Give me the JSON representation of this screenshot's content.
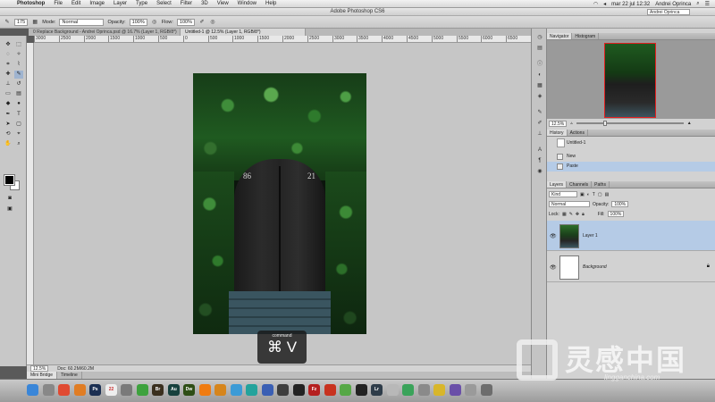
{
  "menubar": {
    "app": "Photoshop",
    "items": [
      "File",
      "Edit",
      "Image",
      "Layer",
      "Type",
      "Select",
      "Filter",
      "3D",
      "View",
      "Window",
      "Help"
    ],
    "clock": "mar 22 jul  12:32",
    "user": "Andrei Oprinca"
  },
  "window": {
    "title": "Adobe Photoshop CS6",
    "workspace": "Andrei Oprinca"
  },
  "options": {
    "brush_size": "175",
    "mode_label": "Mode:",
    "mode_value": "Normal",
    "opacity_label": "Opacity:",
    "opacity_value": "100%",
    "flow_label": "Flow:",
    "flow_value": "100%"
  },
  "tabs": [
    {
      "label": "0 Replace Background - Andrei Oprinca.psd @ 16.7% (Layer 1, RGB/8*)",
      "active": false
    },
    {
      "label": "Untitled-1 @ 12.5% (Layer 1, RGB/8*)",
      "active": true
    }
  ],
  "ruler": [
    "3000",
    "2500",
    "2000",
    "1500",
    "1000",
    "500",
    "0",
    "500",
    "1000",
    "1500",
    "2000",
    "2500",
    "3000",
    "3500",
    "4000",
    "4500",
    "5000",
    "5500",
    "6000",
    "6500"
  ],
  "image": {
    "number_left": "86",
    "number_right": "21"
  },
  "shortcut_overlay": {
    "label": "command",
    "keys": "⌘ V"
  },
  "status": {
    "zoom": "12.5%",
    "doc": "Doc: 60.2M/60.2M"
  },
  "bottom_tabs": [
    "Mini Bridge",
    "Timeline"
  ],
  "navigator": {
    "tabs": [
      "Navigator",
      "Histogram"
    ],
    "zoom": "12.5%"
  },
  "history": {
    "tabs": [
      "History",
      "Actions"
    ],
    "snapshot": "Untitled-1",
    "items": [
      {
        "label": "New",
        "selected": false
      },
      {
        "label": "Paste",
        "selected": true
      }
    ]
  },
  "layers": {
    "tabs": [
      "Layers",
      "Channels",
      "Paths"
    ],
    "filter": "Kind",
    "blend_mode": "Normal",
    "opacity_label": "Opacity:",
    "opacity_value": "100%",
    "lock_label": "Lock:",
    "fill_label": "Fill:",
    "fill_value": "100%",
    "items": [
      {
        "name": "Layer 1",
        "selected": true
      },
      {
        "name": "Background",
        "selected": false
      }
    ]
  },
  "dock": [
    {
      "name": "finder",
      "label": "",
      "color": "#3a86d8"
    },
    {
      "name": "launchpad",
      "label": "",
      "color": "#888888"
    },
    {
      "name": "chrome",
      "label": "",
      "color": "#e04a32"
    },
    {
      "name": "firefox",
      "label": "",
      "color": "#e07d24"
    },
    {
      "name": "photoshop",
      "label": "Ps",
      "color": "#1b2f52"
    },
    {
      "name": "calendar",
      "label": "22",
      "color": "#eeeeee"
    },
    {
      "name": "system-preferences",
      "label": "",
      "color": "#7a7a7a"
    },
    {
      "name": "spotify",
      "label": "",
      "color": "#3ea23e"
    },
    {
      "name": "bridge",
      "label": "Br",
      "color": "#3a2f1e"
    },
    {
      "name": "audition",
      "label": "Au",
      "color": "#16413d"
    },
    {
      "name": "dreamweaver",
      "label": "Dw",
      "color": "#2e4e15"
    },
    {
      "name": "vlc",
      "label": "",
      "color": "#f07b10"
    },
    {
      "name": "app-orange",
      "label": "",
      "color": "#d6851c"
    },
    {
      "name": "safari",
      "label": "",
      "color": "#3c9bd6"
    },
    {
      "name": "app-teal",
      "label": "",
      "color": "#24a39c"
    },
    {
      "name": "app-blue",
      "label": "",
      "color": "#3a5fb4"
    },
    {
      "name": "activity-monitor",
      "label": "",
      "color": "#3e3e3e"
    },
    {
      "name": "terminal",
      "label": "",
      "color": "#222222"
    },
    {
      "name": "filezilla",
      "label": "Fz",
      "color": "#b51f1f"
    },
    {
      "name": "app-red",
      "label": "",
      "color": "#c8321f"
    },
    {
      "name": "app-green",
      "label": "",
      "color": "#56a846"
    },
    {
      "name": "app-black",
      "label": "",
      "color": "#222222"
    },
    {
      "name": "lightroom",
      "label": "Lr",
      "color": "#2e3c49"
    },
    {
      "name": "app-dots",
      "label": "",
      "color": "#b8b8b8"
    },
    {
      "name": "app-green-2",
      "label": "",
      "color": "#3aa35a"
    },
    {
      "name": "app-gray",
      "label": "",
      "color": "#8a8a8a"
    },
    {
      "name": "app-yellow",
      "label": "",
      "color": "#d8b62a"
    },
    {
      "name": "app-purple",
      "label": "",
      "color": "#6a4fa8"
    },
    {
      "name": "app-gray-2",
      "label": "",
      "color": "#9a9a9a"
    },
    {
      "name": "downloads",
      "label": "",
      "color": "#6d6d6d"
    }
  ],
  "watermark": {
    "main": "灵感中国",
    "sub": "lingganchina.com"
  }
}
